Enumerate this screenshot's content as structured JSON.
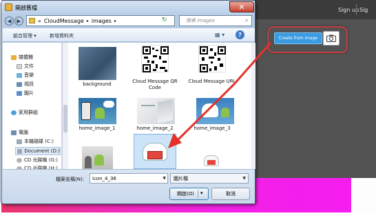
{
  "window": {
    "title": "開啟舊檔",
    "close_glyph": "✕"
  },
  "address": {
    "chevron": "«",
    "segments": [
      "CloudMessage",
      "images"
    ],
    "separator": "▸",
    "refresh_glyph": "↻"
  },
  "search": {
    "placeholder": "搜尋 images",
    "icon": "search-icon"
  },
  "toolbar": {
    "organize": "組合管理 ▾",
    "new_folder": "新增資料夾",
    "view_glyph": "▦ ▾",
    "help_glyph": "?"
  },
  "nav": [
    {
      "label": "媒體櫃",
      "icon": "library-icon",
      "color": "#e7b13a",
      "level": 0
    },
    {
      "label": "文件",
      "icon": "documents-icon",
      "color": "#c9c9c9",
      "level": 1
    },
    {
      "label": "音樂",
      "icon": "music-icon",
      "color": "#6fb0d6",
      "level": 1
    },
    {
      "label": "視訊",
      "icon": "video-icon",
      "color": "#6c8db2",
      "level": 1
    },
    {
      "label": "圖片",
      "icon": "pictures-icon",
      "color": "#5c8fc6",
      "level": 1
    },
    {
      "label": "家用群組",
      "icon": "homegroup-icon",
      "color": "#4aa0d8",
      "level": 0
    },
    {
      "label": "電腦",
      "icon": "computer-icon",
      "color": "#6b8eb1",
      "level": 0
    },
    {
      "label": "本機磁碟 (C:)",
      "icon": "drive-icon",
      "color": "#9aa8b6",
      "level": 1
    },
    {
      "label": "Document (D:)",
      "icon": "drive-icon",
      "color": "#9aa8b6",
      "level": 1,
      "selected": true
    },
    {
      "label": "CD 光碟機 (G:)",
      "icon": "cd-drive-icon",
      "color": "#b4b4b4",
      "level": 1
    },
    {
      "label": "CD 光碟機 (H:)",
      "icon": "cd-drive-icon",
      "color": "#b4b4b4",
      "level": 1
    }
  ],
  "files": [
    {
      "label": "background"
    },
    {
      "label": "Cloud Message QR Code"
    },
    {
      "label": "Cloud Message URL"
    },
    {
      "label": "home_image_1"
    },
    {
      "label": "home_image_2"
    },
    {
      "label": "home_image_3"
    },
    {
      "label": ""
    },
    {
      "label": ""
    },
    {
      "label": ""
    }
  ],
  "filename": {
    "label": "檔案名稱(N):",
    "value": "icon_4_36"
  },
  "filetype": {
    "value": "圖片檔",
    "arrow": "▾"
  },
  "buttons": {
    "open": "開啟(O)",
    "open_arrow": "▾",
    "cancel": "取消"
  },
  "page": {
    "signup": "Sign up",
    "signin": "Sig",
    "create_button": "Create from image",
    "camera_icon": "camera-icon"
  },
  "colors": {
    "accent": "#3a9be3",
    "highlight": "#c63b3f",
    "arrow": "#e5312b"
  }
}
